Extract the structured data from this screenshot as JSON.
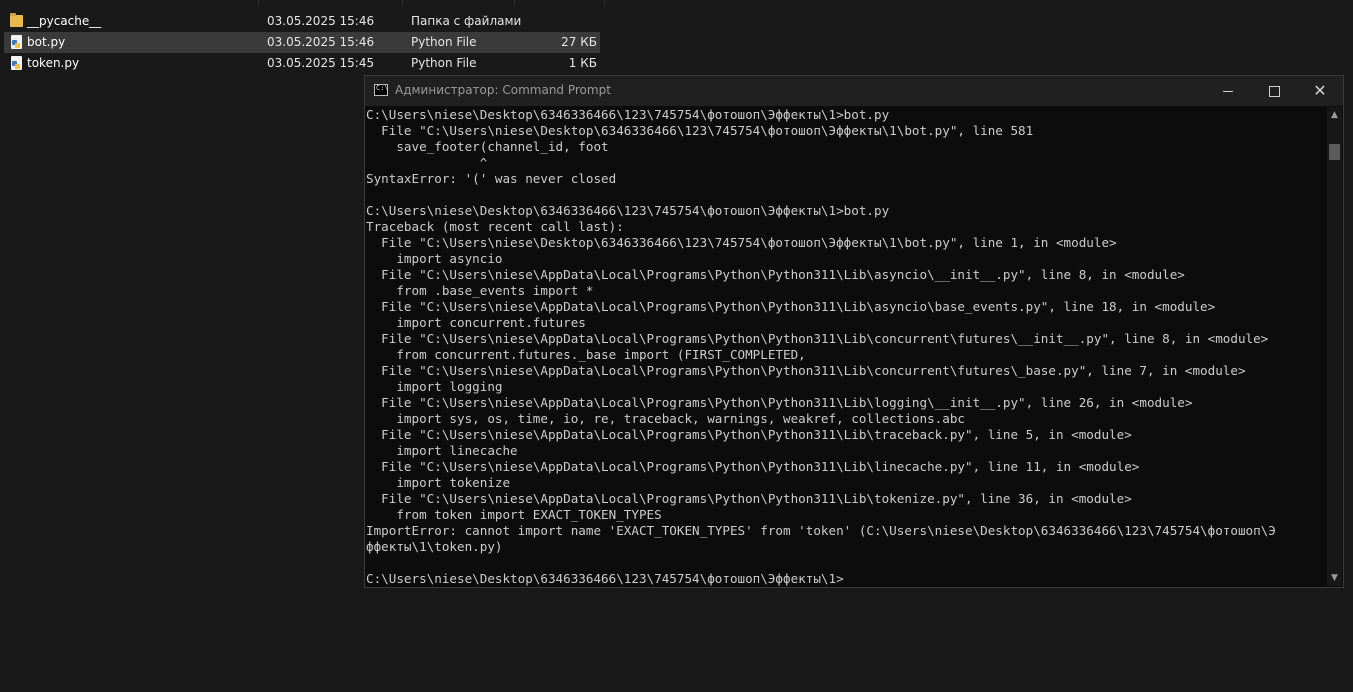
{
  "explorer": {
    "files": [
      {
        "name": "__pycache__",
        "date": "03.05.2025 15:46",
        "type": "Папка с файлами",
        "size": "",
        "icon": "folder-icon"
      },
      {
        "name": "bot.py",
        "date": "03.05.2025 15:46",
        "type": "Python File",
        "size": "27 КБ",
        "icon": "python-file-icon",
        "selected": true
      },
      {
        "name": "token.py",
        "date": "03.05.2025 15:45",
        "type": "Python File",
        "size": "1 КБ",
        "icon": "python-file-icon"
      }
    ]
  },
  "cmd": {
    "title": "Администратор: Command Prompt",
    "buttons": {
      "minimize": "minimize",
      "maximize": "maximize",
      "close": "✕"
    },
    "lines": [
      "C:\\Users\\niese\\Desktop\\6346336466\\123\\745754\\фотошоп\\Эффекты\\1>bot.py",
      "  File \"C:\\Users\\niese\\Desktop\\6346336466\\123\\745754\\фотошоп\\Эффекты\\1\\bot.py\", line 581",
      "    save_footer(channel_id, foot",
      "               ^",
      "SyntaxError: '(' was never closed",
      "",
      "C:\\Users\\niese\\Desktop\\6346336466\\123\\745754\\фотошоп\\Эффекты\\1>bot.py",
      "Traceback (most recent call last):",
      "  File \"C:\\Users\\niese\\Desktop\\6346336466\\123\\745754\\фотошоп\\Эффекты\\1\\bot.py\", line 1, in <module>",
      "    import asyncio",
      "  File \"C:\\Users\\niese\\AppData\\Local\\Programs\\Python\\Python311\\Lib\\asyncio\\__init__.py\", line 8, in <module>",
      "    from .base_events import *",
      "  File \"C:\\Users\\niese\\AppData\\Local\\Programs\\Python\\Python311\\Lib\\asyncio\\base_events.py\", line 18, in <module>",
      "    import concurrent.futures",
      "  File \"C:\\Users\\niese\\AppData\\Local\\Programs\\Python\\Python311\\Lib\\concurrent\\futures\\__init__.py\", line 8, in <module>",
      "    from concurrent.futures._base import (FIRST_COMPLETED,",
      "  File \"C:\\Users\\niese\\AppData\\Local\\Programs\\Python\\Python311\\Lib\\concurrent\\futures\\_base.py\", line 7, in <module>",
      "    import logging",
      "  File \"C:\\Users\\niese\\AppData\\Local\\Programs\\Python\\Python311\\Lib\\logging\\__init__.py\", line 26, in <module>",
      "    import sys, os, time, io, re, traceback, warnings, weakref, collections.abc",
      "  File \"C:\\Users\\niese\\AppData\\Local\\Programs\\Python\\Python311\\Lib\\traceback.py\", line 5, in <module>",
      "    import linecache",
      "  File \"C:\\Users\\niese\\AppData\\Local\\Programs\\Python\\Python311\\Lib\\linecache.py\", line 11, in <module>",
      "    import tokenize",
      "  File \"C:\\Users\\niese\\AppData\\Local\\Programs\\Python\\Python311\\Lib\\tokenize.py\", line 36, in <module>",
      "    from token import EXACT_TOKEN_TYPES",
      "ImportError: cannot import name 'EXACT_TOKEN_TYPES' from 'token' (C:\\Users\\niese\\Desktop\\6346336466\\123\\745754\\фотошоп\\Э",
      "ффекты\\1\\token.py)",
      "",
      "C:\\Users\\niese\\Desktop\\6346336466\\123\\745754\\фотошоп\\Эффекты\\1>"
    ],
    "scrollbar": {
      "up": "▲",
      "down": "▼"
    }
  }
}
